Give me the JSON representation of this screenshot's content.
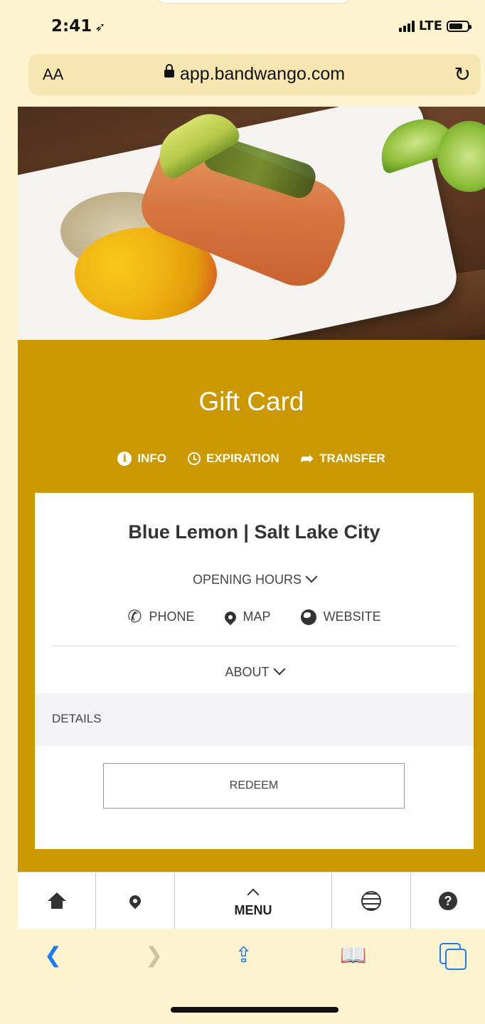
{
  "status": {
    "time": "2:41",
    "network": "LTE"
  },
  "browser": {
    "text_size": "AA",
    "url": "app.bandwango.com"
  },
  "page": {
    "title": "Gift Card",
    "tabs": [
      {
        "label": "INFO"
      },
      {
        "label": "EXPIRATION"
      },
      {
        "label": "TRANSFER"
      }
    ]
  },
  "card": {
    "venue": "Blue Lemon | Salt Lake City",
    "opening_hours": "OPENING HOURS",
    "contacts": [
      {
        "label": "PHONE"
      },
      {
        "label": "MAP"
      },
      {
        "label": "WEBSITE"
      }
    ],
    "about": "ABOUT",
    "details": "DETAILS",
    "redeem": "REDEEM"
  },
  "appnav": {
    "menu": "MENU"
  },
  "colors": {
    "gold": "#cc9800",
    "safari_tint": "#fdf3cf",
    "link_blue": "#1a7cf5"
  },
  "icons": [
    "navigation-arrow-icon",
    "signal-icon",
    "battery-icon",
    "lock-icon",
    "reload-icon",
    "info-icon",
    "clock-icon",
    "share-arrow-icon",
    "phone-icon",
    "map-pin-icon",
    "globe-icon",
    "chevron-down-icon",
    "home-icon",
    "location-icon",
    "chevron-up-icon",
    "web-icon",
    "help-icon",
    "back-icon",
    "forward-icon",
    "share-icon",
    "bookmarks-icon",
    "tabs-icon"
  ]
}
